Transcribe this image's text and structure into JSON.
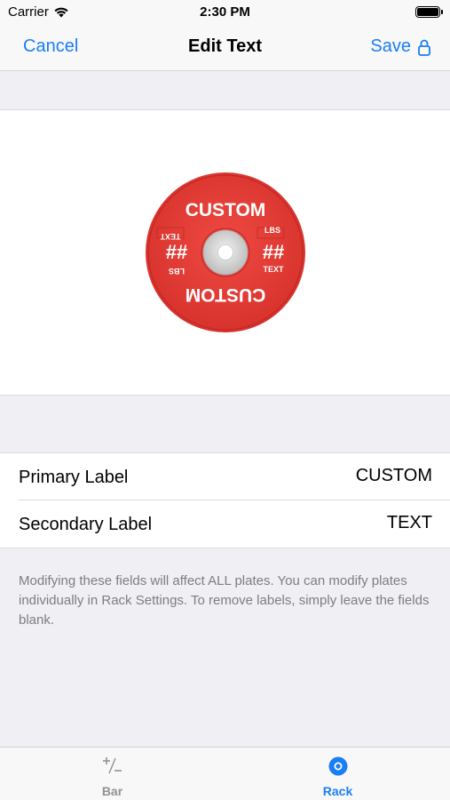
{
  "status": {
    "carrier": "Carrier",
    "time": "2:30 PM"
  },
  "nav": {
    "cancel": "Cancel",
    "title": "Edit Text",
    "save": "Save"
  },
  "plate": {
    "top_text": "CUSTOM",
    "bottom_text": "CUSTOM",
    "left_number": "##",
    "right_number": "##",
    "left_top_small": "TEXT",
    "left_bottom_small": "LBS",
    "right_top_small": "LBS",
    "right_bottom_small": "TEXT",
    "color": "#e03a34"
  },
  "form": {
    "primary": {
      "label": "Primary Label",
      "value": "CUSTOM"
    },
    "secondary": {
      "label": "Secondary Label",
      "value": "TEXT"
    }
  },
  "footnote": "Modifying these fields will affect ALL plates. You can modify plates individually in Rack Settings. To remove labels, simply leave the fields blank.",
  "tabs": [
    {
      "label": "Bar",
      "icon": "plus-minus-icon"
    },
    {
      "label": "Rack",
      "icon": "rack-plate-icon"
    }
  ],
  "colors": {
    "accent": "#1a7ef5",
    "inactive": "#929297"
  }
}
